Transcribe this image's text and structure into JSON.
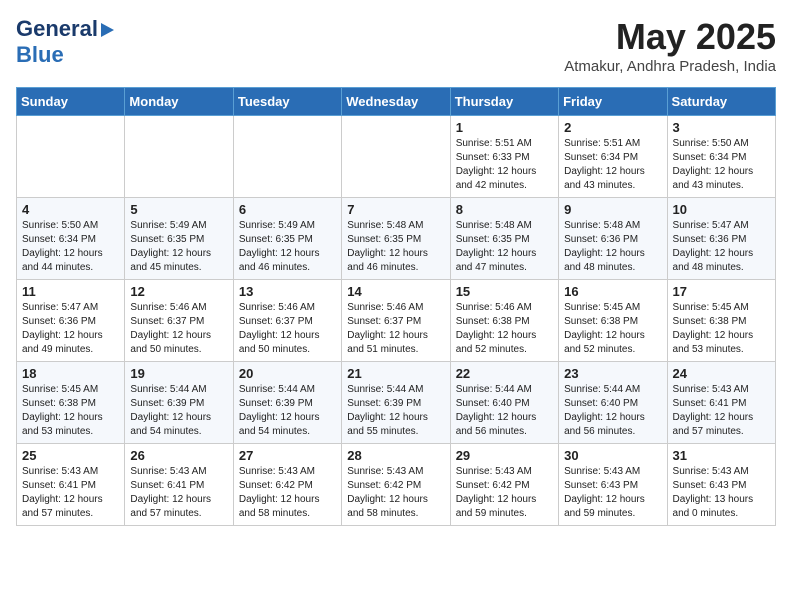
{
  "logo": {
    "line1": "General",
    "line2": "Blue"
  },
  "title": "May 2025",
  "location": "Atmakur, Andhra Pradesh, India",
  "days_header": [
    "Sunday",
    "Monday",
    "Tuesday",
    "Wednesday",
    "Thursday",
    "Friday",
    "Saturday"
  ],
  "weeks": [
    [
      {
        "day": "",
        "info": ""
      },
      {
        "day": "",
        "info": ""
      },
      {
        "day": "",
        "info": ""
      },
      {
        "day": "",
        "info": ""
      },
      {
        "day": "1",
        "info": "Sunrise: 5:51 AM\nSunset: 6:33 PM\nDaylight: 12 hours\nand 42 minutes."
      },
      {
        "day": "2",
        "info": "Sunrise: 5:51 AM\nSunset: 6:34 PM\nDaylight: 12 hours\nand 43 minutes."
      },
      {
        "day": "3",
        "info": "Sunrise: 5:50 AM\nSunset: 6:34 PM\nDaylight: 12 hours\nand 43 minutes."
      }
    ],
    [
      {
        "day": "4",
        "info": "Sunrise: 5:50 AM\nSunset: 6:34 PM\nDaylight: 12 hours\nand 44 minutes."
      },
      {
        "day": "5",
        "info": "Sunrise: 5:49 AM\nSunset: 6:35 PM\nDaylight: 12 hours\nand 45 minutes."
      },
      {
        "day": "6",
        "info": "Sunrise: 5:49 AM\nSunset: 6:35 PM\nDaylight: 12 hours\nand 46 minutes."
      },
      {
        "day": "7",
        "info": "Sunrise: 5:48 AM\nSunset: 6:35 PM\nDaylight: 12 hours\nand 46 minutes."
      },
      {
        "day": "8",
        "info": "Sunrise: 5:48 AM\nSunset: 6:35 PM\nDaylight: 12 hours\nand 47 minutes."
      },
      {
        "day": "9",
        "info": "Sunrise: 5:48 AM\nSunset: 6:36 PM\nDaylight: 12 hours\nand 48 minutes."
      },
      {
        "day": "10",
        "info": "Sunrise: 5:47 AM\nSunset: 6:36 PM\nDaylight: 12 hours\nand 48 minutes."
      }
    ],
    [
      {
        "day": "11",
        "info": "Sunrise: 5:47 AM\nSunset: 6:36 PM\nDaylight: 12 hours\nand 49 minutes."
      },
      {
        "day": "12",
        "info": "Sunrise: 5:46 AM\nSunset: 6:37 PM\nDaylight: 12 hours\nand 50 minutes."
      },
      {
        "day": "13",
        "info": "Sunrise: 5:46 AM\nSunset: 6:37 PM\nDaylight: 12 hours\nand 50 minutes."
      },
      {
        "day": "14",
        "info": "Sunrise: 5:46 AM\nSunset: 6:37 PM\nDaylight: 12 hours\nand 51 minutes."
      },
      {
        "day": "15",
        "info": "Sunrise: 5:46 AM\nSunset: 6:38 PM\nDaylight: 12 hours\nand 52 minutes."
      },
      {
        "day": "16",
        "info": "Sunrise: 5:45 AM\nSunset: 6:38 PM\nDaylight: 12 hours\nand 52 minutes."
      },
      {
        "day": "17",
        "info": "Sunrise: 5:45 AM\nSunset: 6:38 PM\nDaylight: 12 hours\nand 53 minutes."
      }
    ],
    [
      {
        "day": "18",
        "info": "Sunrise: 5:45 AM\nSunset: 6:38 PM\nDaylight: 12 hours\nand 53 minutes."
      },
      {
        "day": "19",
        "info": "Sunrise: 5:44 AM\nSunset: 6:39 PM\nDaylight: 12 hours\nand 54 minutes."
      },
      {
        "day": "20",
        "info": "Sunrise: 5:44 AM\nSunset: 6:39 PM\nDaylight: 12 hours\nand 54 minutes."
      },
      {
        "day": "21",
        "info": "Sunrise: 5:44 AM\nSunset: 6:39 PM\nDaylight: 12 hours\nand 55 minutes."
      },
      {
        "day": "22",
        "info": "Sunrise: 5:44 AM\nSunset: 6:40 PM\nDaylight: 12 hours\nand 56 minutes."
      },
      {
        "day": "23",
        "info": "Sunrise: 5:44 AM\nSunset: 6:40 PM\nDaylight: 12 hours\nand 56 minutes."
      },
      {
        "day": "24",
        "info": "Sunrise: 5:43 AM\nSunset: 6:41 PM\nDaylight: 12 hours\nand 57 minutes."
      }
    ],
    [
      {
        "day": "25",
        "info": "Sunrise: 5:43 AM\nSunset: 6:41 PM\nDaylight: 12 hours\nand 57 minutes."
      },
      {
        "day": "26",
        "info": "Sunrise: 5:43 AM\nSunset: 6:41 PM\nDaylight: 12 hours\nand 57 minutes."
      },
      {
        "day": "27",
        "info": "Sunrise: 5:43 AM\nSunset: 6:42 PM\nDaylight: 12 hours\nand 58 minutes."
      },
      {
        "day": "28",
        "info": "Sunrise: 5:43 AM\nSunset: 6:42 PM\nDaylight: 12 hours\nand 58 minutes."
      },
      {
        "day": "29",
        "info": "Sunrise: 5:43 AM\nSunset: 6:42 PM\nDaylight: 12 hours\nand 59 minutes."
      },
      {
        "day": "30",
        "info": "Sunrise: 5:43 AM\nSunset: 6:43 PM\nDaylight: 12 hours\nand 59 minutes."
      },
      {
        "day": "31",
        "info": "Sunrise: 5:43 AM\nSunset: 6:43 PM\nDaylight: 13 hours\nand 0 minutes."
      }
    ]
  ]
}
